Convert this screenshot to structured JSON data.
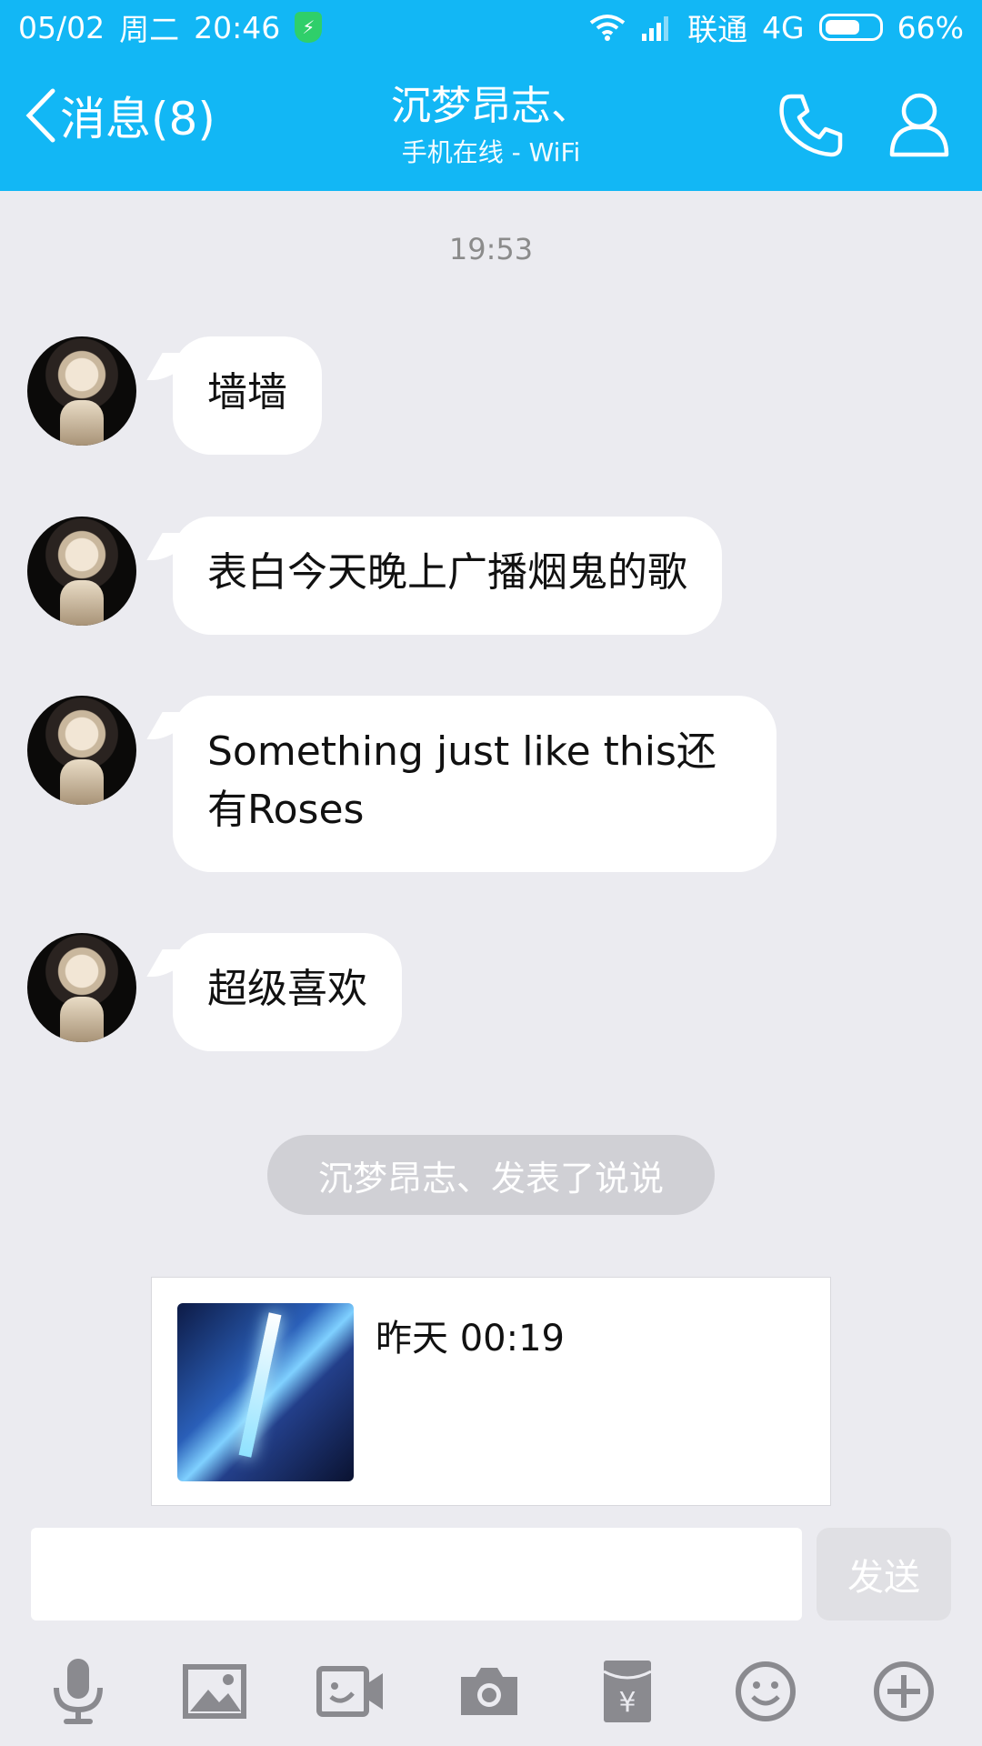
{
  "status_bar": {
    "date": "05/02",
    "weekday": "周二",
    "time": "20:46",
    "carrier": "联通",
    "network": "4G",
    "battery_percent": "66%",
    "battery_level": 0.66
  },
  "nav": {
    "back_label": "消息(8)",
    "contact_name": "沉梦昂志、",
    "contact_status": "手机在线 - WiFi"
  },
  "chat": {
    "timestamp": "19:53",
    "messages": [
      {
        "text": "墙墙"
      },
      {
        "text": "表白今天晚上广播烟鬼的歌"
      },
      {
        "text_line1": "Something just like this还",
        "text_line2": "有Roses"
      },
      {
        "text": "超级喜欢"
      }
    ],
    "notice": "沉梦昂志、发表了说说",
    "card": {
      "time": "昨天 00:19"
    }
  },
  "composer": {
    "input_value": "",
    "send_label": "发送"
  },
  "toolbar": {
    "items": [
      "microphone-icon",
      "image-icon",
      "video-call-icon",
      "camera-icon",
      "red-packet-icon",
      "emoji-icon",
      "plus-icon"
    ]
  },
  "colors": {
    "header": "#12b7f5",
    "background": "#ebebf0",
    "bubble": "#ffffff",
    "icon_gray": "#8a8a8f"
  }
}
